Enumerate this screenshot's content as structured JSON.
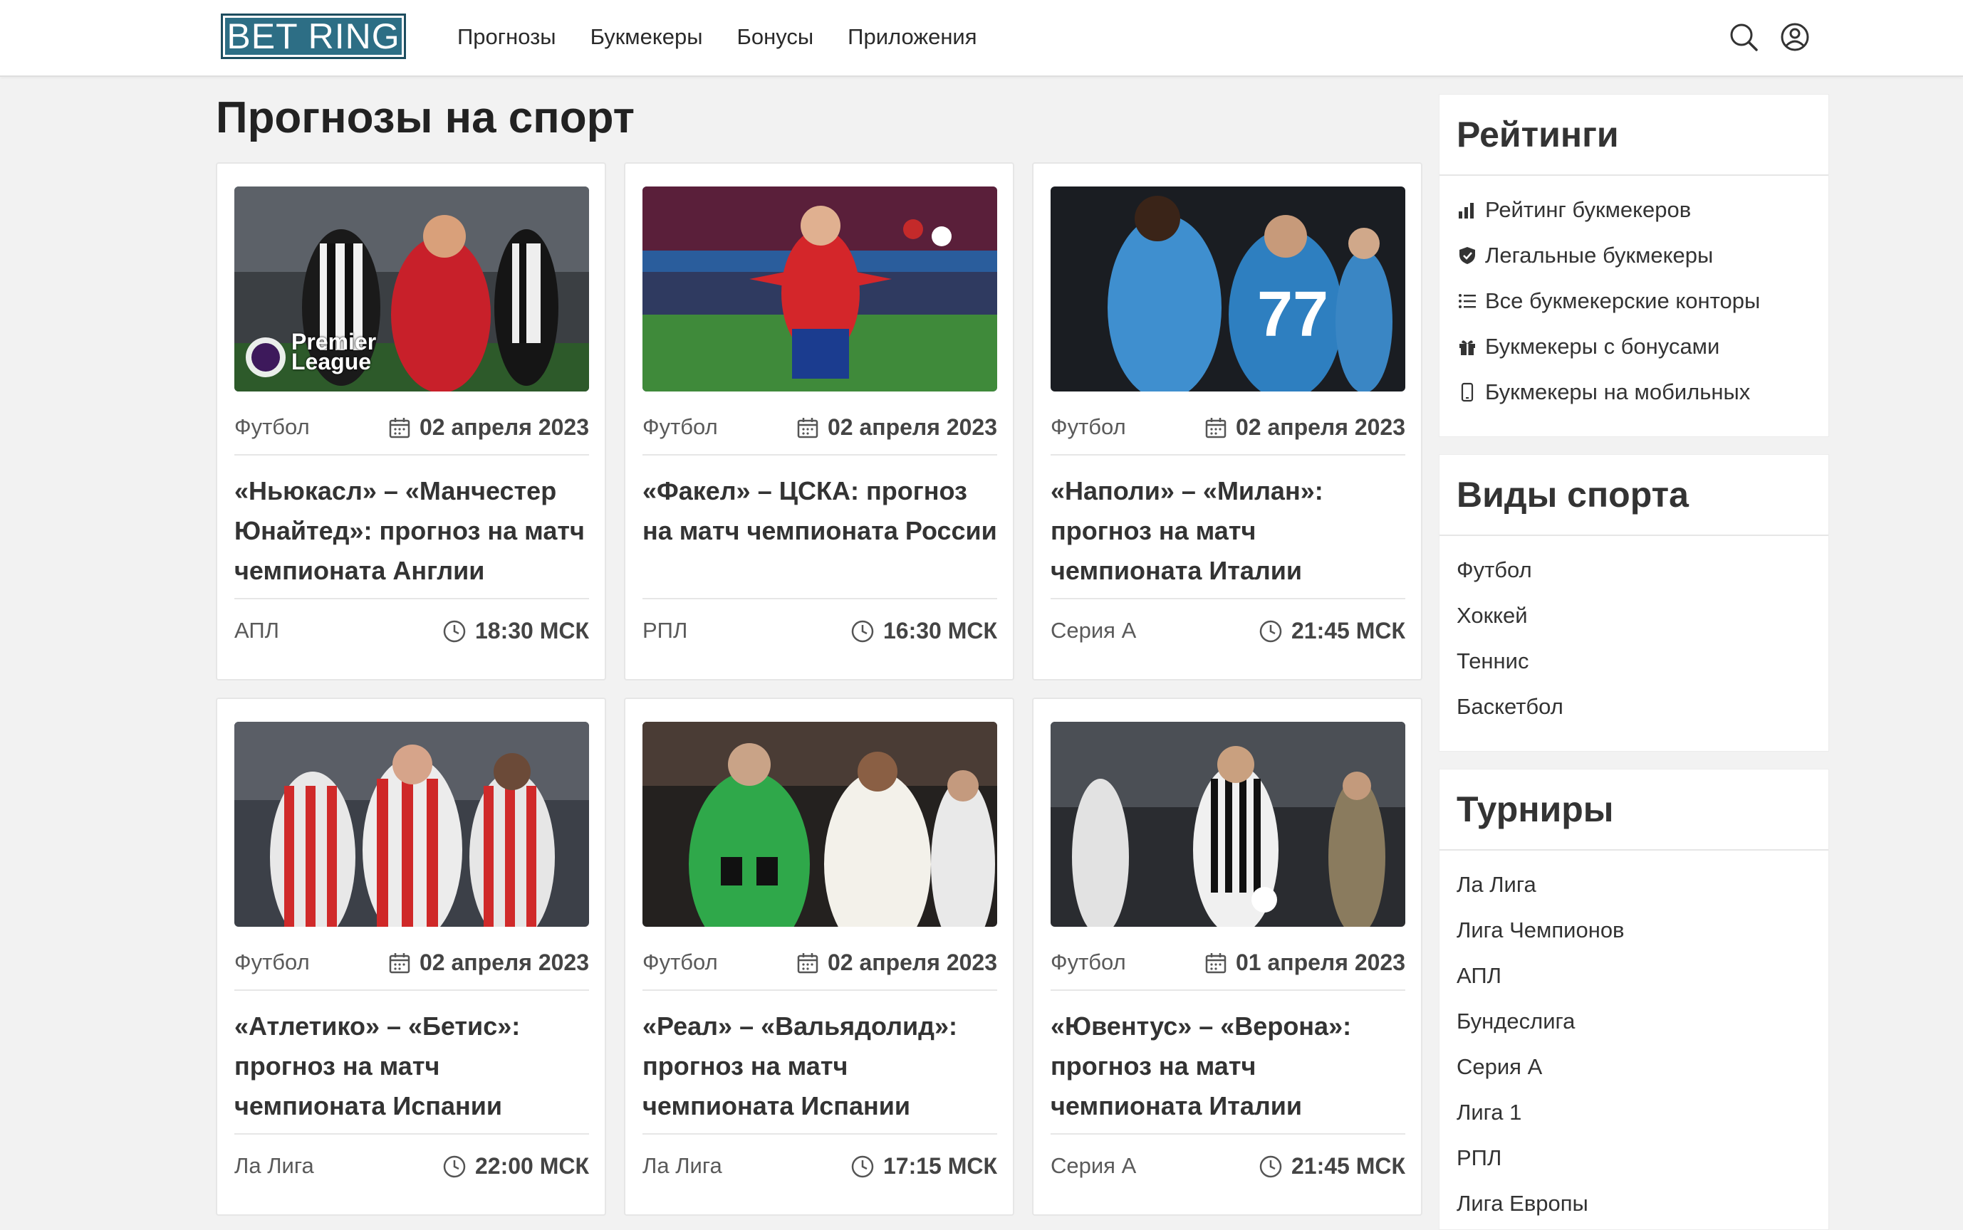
{
  "header": {
    "logo": "BET RING",
    "nav": [
      "Прогнозы",
      "Букмекеры",
      "Бонусы",
      "Приложения"
    ],
    "icons": [
      "search-icon",
      "user-icon"
    ]
  },
  "page": {
    "title": "Прогнозы на спорт"
  },
  "cards": [
    {
      "sport": "Футбол",
      "date": "02 апреля 2023",
      "title": "«Ньюкасл» – «Манчестер Юнайтед»: прогноз на матч чемпионата Англии",
      "league": "АПЛ",
      "time": "18:30 МСК",
      "badge": "Premier League"
    },
    {
      "sport": "Футбол",
      "date": "02 апреля 2023",
      "title": "«Факел» – ЦСКА: прогноз на матч чемпионата России",
      "league": "РПЛ",
      "time": "16:30 МСК"
    },
    {
      "sport": "Футбол",
      "date": "02 апреля 2023",
      "title": "«Наполи» – «Милан»: прогноз на матч чемпионата Италии",
      "league": "Серия А",
      "time": "21:45 МСК"
    },
    {
      "sport": "Футбол",
      "date": "02 апреля 2023",
      "title": "«Атлетико» – «Бетис»: прогноз на матч чемпионата Испании",
      "league": "Ла Лига",
      "time": "22:00 МСК"
    },
    {
      "sport": "Футбол",
      "date": "02 апреля 2023",
      "title": "«Реал» – «Вальядолид»: прогноз на матч чемпионата Испании",
      "league": "Ла Лига",
      "time": "17:15 МСК"
    },
    {
      "sport": "Футбол",
      "date": "01 апреля 2023",
      "title": "«Ювентус» – «Верона»: прогноз на матч чемпионата Италии",
      "league": "Серия А",
      "time": "21:45 МСК"
    }
  ],
  "sidebar": {
    "ratings": {
      "title": "Рейтинги",
      "items": [
        {
          "label": "Рейтинг букмекеров",
          "icon": "bar-chart-icon"
        },
        {
          "label": "Легальные букмекеры",
          "icon": "shield-check-icon"
        },
        {
          "label": "Все букмекерские конторы",
          "icon": "list-icon"
        },
        {
          "label": "Букмекеры с бонусами",
          "icon": "gift-icon"
        },
        {
          "label": "Букмекеры на мобильных",
          "icon": "mobile-icon"
        }
      ]
    },
    "sports": {
      "title": "Виды спорта",
      "items": [
        "Футбол",
        "Хоккей",
        "Теннис",
        "Баскетбол"
      ]
    },
    "tournaments": {
      "title": "Турниры",
      "items": [
        "Ла Лига",
        "Лига Чемпионов",
        "АПЛ",
        "Бундеслига",
        "Серия А",
        "Лига 1",
        "РПЛ",
        "Лига Европы"
      ]
    }
  },
  "colors": {
    "logo_bg": "#2d6e85",
    "page_bg": "#f2f2f2"
  }
}
